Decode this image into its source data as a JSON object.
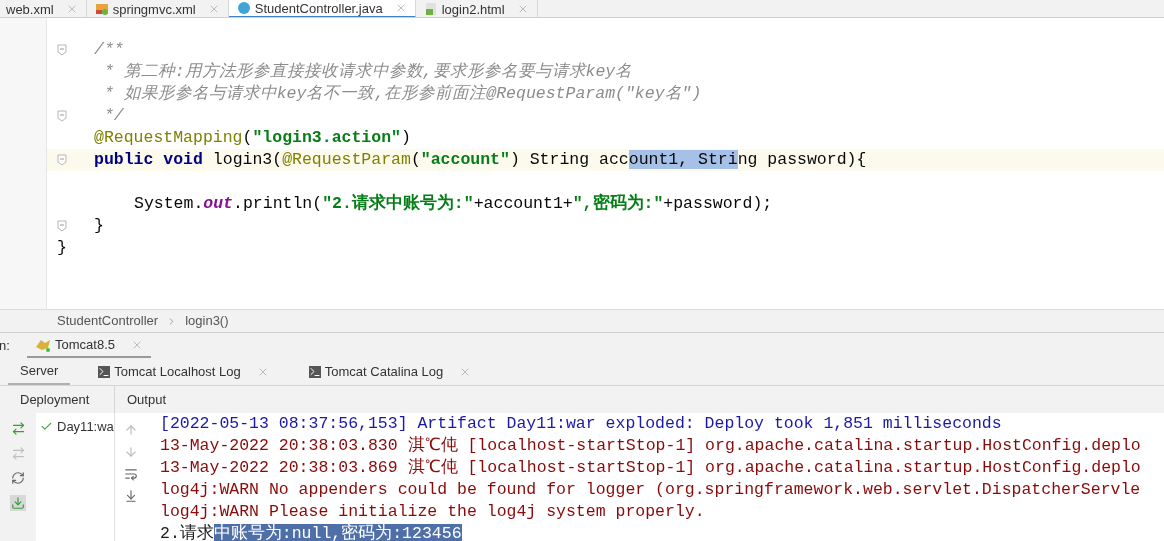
{
  "editor_tabs": [
    {
      "label": "web.xml",
      "kind": "xml",
      "selected": false
    },
    {
      "label": "springmvc.xml",
      "kind": "spring",
      "selected": false
    },
    {
      "label": "StudentController.java",
      "kind": "class",
      "selected": true
    },
    {
      "label": "login2.html",
      "kind": "html",
      "selected": false
    }
  ],
  "code_lines": [
    {
      "kind": "member",
      "current": false,
      "fold": true,
      "tokens": [
        {
          "text": "/**",
          "kind": "comment"
        }
      ]
    },
    {
      "kind": "member",
      "current": false,
      "fold": false,
      "tokens": [
        {
          "text": " * 第二种:用方法形参直接接收请求中参数,要求形参名要与请求key名",
          "kind": "comment"
        }
      ]
    },
    {
      "kind": "member",
      "current": false,
      "fold": false,
      "tokens": [
        {
          "text": " * 如果形参名与请求中key名不一致,在形参前面注@RequestParam(\"key名\")",
          "kind": "comment"
        }
      ]
    },
    {
      "kind": "member",
      "current": false,
      "fold": true,
      "tokens": [
        {
          "text": " */",
          "kind": "comment"
        }
      ]
    },
    {
      "kind": "member",
      "current": false,
      "fold": false,
      "tokens": [
        {
          "text": "@RequestMapping",
          "kind": "annotation"
        },
        {
          "text": "(",
          "kind": "plain"
        },
        {
          "text": "\"login3.action\"",
          "kind": "string"
        },
        {
          "text": ")",
          "kind": "plain"
        }
      ]
    },
    {
      "kind": "member",
      "current": true,
      "fold": true,
      "tokens": [
        {
          "text": "public void ",
          "kind": "keyword"
        },
        {
          "text": "login3(",
          "kind": "plain"
        },
        {
          "text": "@RequestParam",
          "kind": "annotation"
        },
        {
          "text": "(",
          "kind": "plain"
        },
        {
          "text": "\"account\"",
          "kind": "string"
        },
        {
          "text": ") String acc",
          "kind": "plain"
        },
        {
          "text": "ount1, Stri",
          "kind": "selected"
        },
        {
          "text": "ng password){",
          "kind": "plain"
        }
      ]
    },
    {
      "kind": "blank",
      "current": false,
      "fold": false
    },
    {
      "kind": "body",
      "current": false,
      "fold": false,
      "tokens": [
        {
          "text": "System.",
          "kind": "plain"
        },
        {
          "text": "out",
          "kind": "static"
        },
        {
          "text": ".println(",
          "kind": "plain"
        },
        {
          "text": "\"2.请求中账号为:\"",
          "kind": "string"
        },
        {
          "text": "+account1+",
          "kind": "plain"
        },
        {
          "text": "\",密码为:\"",
          "kind": "string"
        },
        {
          "text": "+password);",
          "kind": "plain"
        }
      ]
    },
    {
      "kind": "member",
      "current": false,
      "fold": true,
      "tokens": [
        {
          "text": "}",
          "kind": "plain"
        }
      ]
    },
    {
      "kind": "class",
      "current": false,
      "fold": false,
      "tokens": [
        {
          "text": "}",
          "kind": "plain"
        }
      ]
    }
  ],
  "breadcrumbs": [
    "StudentController",
    "login3()"
  ],
  "run_bar": {
    "label": "n:",
    "tab": "Tomcat8.5"
  },
  "server_tabs": [
    {
      "label": "Server",
      "log": false,
      "closable": false,
      "selected": true
    },
    {
      "label": "Tomcat Localhost Log",
      "log": true,
      "closable": true,
      "selected": false
    },
    {
      "label": "Tomcat Catalina Log",
      "log": true,
      "closable": true,
      "selected": false
    }
  ],
  "panel_headers": [
    "Deployment",
    "Output"
  ],
  "deployments": [
    {
      "label": "Day11:wa",
      "ok": true
    }
  ],
  "console_lines": [
    {
      "tokens": [
        {
          "text": "[2022-05-13 08:37:56,153] Artifact Day11:war exploded: Deploy took 1,851 milliseconds",
          "kind": "info"
        }
      ]
    },
    {
      "tokens": [
        {
          "text": "13-May-2022 20:38:03.830 淇℃伅 [localhost-startStop-1] org.apache.catalina.startup.HostConfig.deplo",
          "kind": "error"
        }
      ]
    },
    {
      "tokens": [
        {
          "text": "13-May-2022 20:38:03.869 淇℃伅 [localhost-startStop-1] org.apache.catalina.startup.HostConfig.deplo",
          "kind": "error"
        }
      ]
    },
    {
      "tokens": [
        {
          "text": "log4j:WARN No appenders could be found for logger (org.springframework.web.servlet.DispatcherServle",
          "kind": "error"
        }
      ]
    },
    {
      "tokens": [
        {
          "text": "log4j:WARN Please initialize the log4j system properly.",
          "kind": "error"
        }
      ]
    },
    {
      "tokens": [
        {
          "text": "2.请求",
          "kind": "out"
        },
        {
          "text": "中账号为:null,密码为:123456",
          "kind": "selected"
        }
      ]
    }
  ]
}
